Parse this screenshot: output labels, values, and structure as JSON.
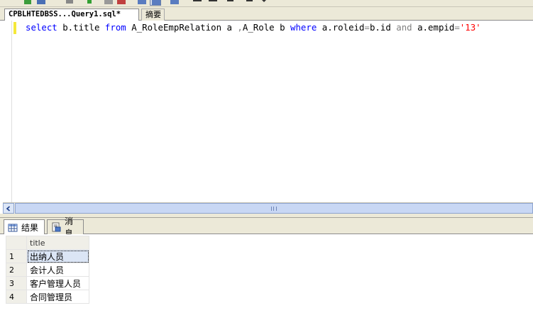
{
  "editor_tabs": [
    {
      "label": "CPBLHTEDBSS...Query1.sql*",
      "active": true
    },
    {
      "label": "摘要",
      "active": false
    }
  ],
  "query": {
    "parts": [
      {
        "t": "kw",
        "v": "select"
      },
      {
        "t": "id",
        "v": " b.title "
      },
      {
        "t": "kw",
        "v": "from"
      },
      {
        "t": "id",
        "v": " A_RoleEmpRelation a "
      },
      {
        "t": "op",
        "v": ","
      },
      {
        "t": "id",
        "v": "A_Role b "
      },
      {
        "t": "kw",
        "v": "where"
      },
      {
        "t": "id",
        "v": " a.roleid"
      },
      {
        "t": "op",
        "v": "="
      },
      {
        "t": "id",
        "v": "b.id "
      },
      {
        "t": "op",
        "v": "and"
      },
      {
        "t": "id",
        "v": " a.empid"
      },
      {
        "t": "op",
        "v": "="
      },
      {
        "t": "str",
        "v": "'13'"
      }
    ]
  },
  "result_tabs": [
    {
      "label": "结果",
      "icon": "grid-icon",
      "active": true
    },
    {
      "label": "消息",
      "icon": "message-icon",
      "active": false
    }
  ],
  "results": {
    "columns": [
      "title"
    ],
    "rows": [
      {
        "num": "1",
        "cells": [
          "出纳人员"
        ]
      },
      {
        "num": "2",
        "cells": [
          "会计人员"
        ]
      },
      {
        "num": "3",
        "cells": [
          "客户管理人员"
        ]
      },
      {
        "num": "4",
        "cells": [
          "合同管理员"
        ]
      }
    ]
  },
  "colors": {
    "keyword": "#0000ff",
    "operator": "#808080",
    "string": "#ff0000",
    "chrome": "#ece9d8"
  }
}
